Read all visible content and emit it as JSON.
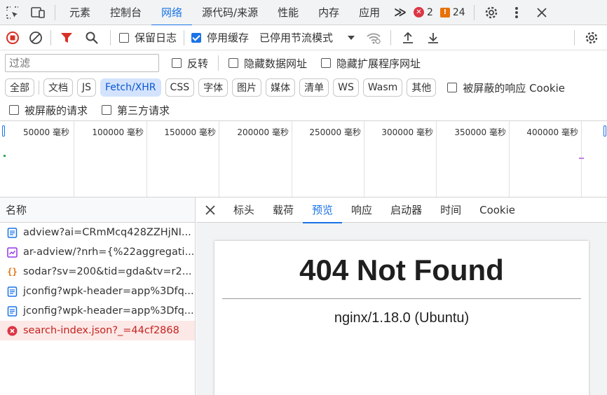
{
  "top_tabs": [
    "元素",
    "控制台",
    "网络",
    "源代码/来源",
    "性能",
    "内存",
    "应用"
  ],
  "more_tabs": "≫",
  "errors_count": "2",
  "warnings_count": "24",
  "toolbar": {
    "preserve_log": "保留日志",
    "disable_cache": "停用缓存",
    "throttling": "已停用节流模式"
  },
  "filter": {
    "placeholder": "过滤",
    "invert": "反转",
    "hide_data_urls": "隐藏数据网址",
    "hide_ext_urls": "隐藏扩展程序网址"
  },
  "types": [
    "全部",
    "文档",
    "JS",
    "Fetch/XHR",
    "CSS",
    "字体",
    "图片",
    "媒体",
    "清单",
    "WS",
    "Wasm",
    "其他"
  ],
  "blocked_cookies": "被屏蔽的响应 Cookie",
  "blocked_requests": "被屏蔽的请求",
  "third_party": "第三方请求",
  "timeline_ticks": [
    "50000 毫秒",
    "100000 毫秒",
    "150000 毫秒",
    "200000 毫秒",
    "250000 毫秒",
    "300000 毫秒",
    "350000 毫秒",
    "400000 毫秒"
  ],
  "name_header": "名称",
  "requests": [
    {
      "name": "adview?ai=CRmMcq428ZZHjNI...",
      "icon": "document-icon",
      "status": "ok"
    },
    {
      "name": "ar-adview/?nrh={%22aggregati...",
      "icon": "xhr-icon",
      "status": "ok"
    },
    {
      "name": "sodar?sv=200&tid=gda&tv=r2...",
      "icon": "script-icon",
      "status": "ok"
    },
    {
      "name": "jconfig?wpk-header=app%3Dfq...",
      "icon": "document-icon",
      "status": "ok"
    },
    {
      "name": "jconfig?wpk-header=app%3Dfq...",
      "icon": "document-icon",
      "status": "ok"
    },
    {
      "name": "search-index.json?_=44cf2868",
      "icon": "error-icon",
      "status": "error"
    }
  ],
  "detail_tabs": [
    "标头",
    "载荷",
    "预览",
    "响应",
    "启动器",
    "时间",
    "Cookie"
  ],
  "preview": {
    "title": "404 Not Found",
    "server": "nginx/1.18.0 (Ubuntu)"
  },
  "colors": {
    "accent": "#1a73e8",
    "error": "#dc3545",
    "warning": "#e8710a",
    "record": "#d93025"
  }
}
